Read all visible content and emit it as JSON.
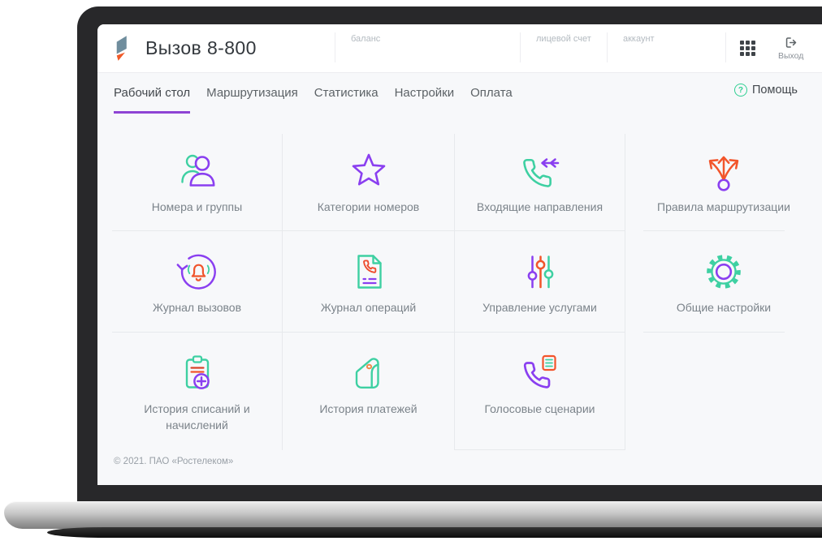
{
  "header": {
    "title": "Вызов 8-800",
    "meta": [
      {
        "label": "баланс"
      },
      {
        "label": "лицевой счет"
      },
      {
        "label": "аккаунт"
      }
    ],
    "logout_label": "Выход"
  },
  "nav": {
    "tabs": [
      {
        "label": "Рабочий стол",
        "active": true
      },
      {
        "label": "Маршрутизация",
        "active": false
      },
      {
        "label": "Статистика",
        "active": false
      },
      {
        "label": "Настройки",
        "active": false
      },
      {
        "label": "Оплата",
        "active": false
      }
    ],
    "help": {
      "glyph": "?",
      "label": "Помощь"
    }
  },
  "tiles": [
    {
      "label": "Номера и группы",
      "icon": "users-icon"
    },
    {
      "label": "Категории номеров",
      "icon": "star-icon"
    },
    {
      "label": "Входящие направления",
      "icon": "incoming-call-icon"
    },
    {
      "label": "Правила маршрутизации",
      "icon": "routing-arrows-icon"
    },
    {
      "label": "Журнал вызовов",
      "icon": "call-journal-icon"
    },
    {
      "label": "Журнал операций",
      "icon": "operations-journal-icon"
    },
    {
      "label": "Управление услугами",
      "icon": "sliders-icon"
    },
    {
      "label": "Общие настройки",
      "icon": "gear-icon"
    },
    {
      "label": "История списаний и начислений",
      "icon": "charges-history-icon"
    },
    {
      "label": "История платежей",
      "icon": "wallet-icon"
    },
    {
      "label": "Голосовые сценарии",
      "icon": "voice-script-icon"
    }
  ],
  "footer": {
    "copyright": "© 2021. ПАО «Ростелеком»"
  },
  "colors": {
    "purple": "#8a3ff0",
    "green": "#3ed0a2",
    "orange": "#f2552b",
    "slate": "#6f8d9d",
    "tab_underline": "#8e44d4",
    "help_green": "#2fcf92"
  }
}
